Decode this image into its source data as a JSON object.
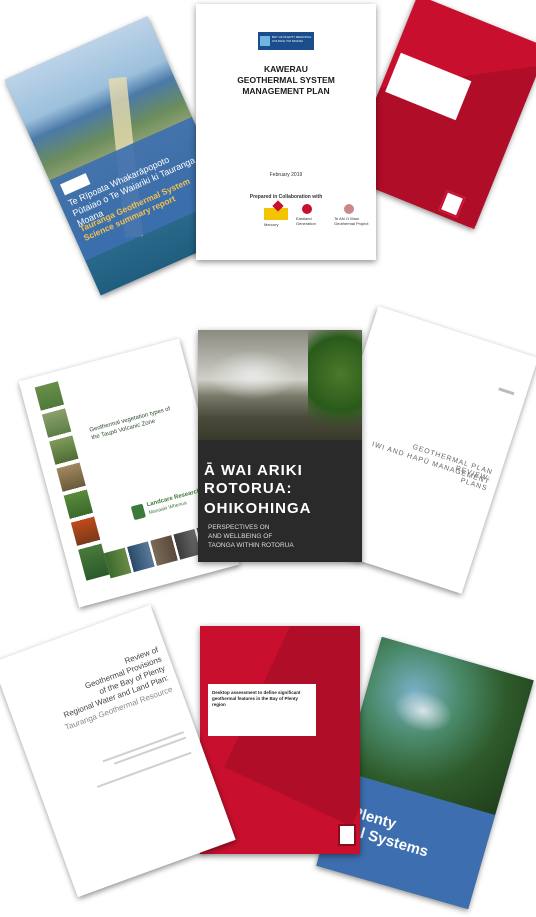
{
  "colors": {
    "red": "#c8102e",
    "navy": "#1b2a4a",
    "blue_band": "#3d6fb0",
    "dark": "#2a2a2a",
    "green": "#3b7a3a"
  },
  "doc1": {
    "title_maori": "Te Rīpoata Whakarāpopoto Pūtaiao o Te Waiariki ki Tauranga Moana",
    "title_en": "Tauranga Geothermal System Science summary report"
  },
  "doc2": {
    "logo": "BAY OF PLENTY REGIONAL COUNCIL TOI MOANA",
    "title": "KAWERAU GEOTHERMAL SYSTEM MANAGEMENT PLAN",
    "date": "February 2019",
    "collab": "Prepared in Collaboration with",
    "partners": [
      "Mercury",
      "Eastland Generation",
      "Te Ahi O Maui Geothermal Project"
    ]
  },
  "doc4": {
    "title": "Geothermal vegetation types of the Taupō Volcanic Zone",
    "org": "Landcare Research",
    "org_maori": "Manaaki Whenua"
  },
  "doc5": {
    "title_line1": "Ā WAI ARIKI",
    "title_line2": "ROTORUA:",
    "title_line3": "OHIKOHINGA",
    "subtitle_line1": "PERSPECTIVES ON",
    "subtitle_line2": "AND WELLBEING OF",
    "subtitle_line3": "TAONGA WITHIN ROTORUA"
  },
  "doc6": {
    "title_line1": "GEOTHERMAL PLAN REVIEW:",
    "title_line2": "IWI AND HAPŪ MANAGEMENT PLANS"
  },
  "doc7": {
    "title_line1": "Review of",
    "title_line2": "Geothermal Provisions",
    "title_line3": "of the Bay of Plenty",
    "title_line4": "Regional Water and Land Plan:",
    "subtitle": "Tauranga Geothermal Resource"
  },
  "doc8": {
    "title": "Desktop assessment to define significant geothermal features in the Bay of Plenty region"
  },
  "doc9": {
    "title_line1": "Plenty",
    "title_line2": "rmal Systems"
  }
}
